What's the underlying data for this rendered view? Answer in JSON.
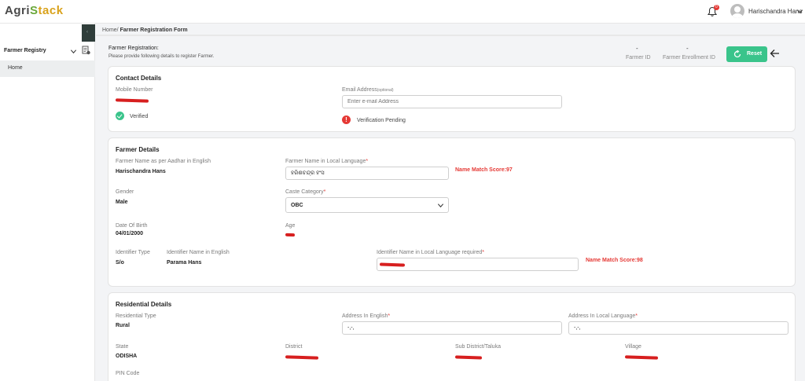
{
  "header": {
    "logo": {
      "part1": "Agri",
      "part2": "S",
      "part3": "tack"
    },
    "notification_count": "0",
    "user_name": "Harischandra Hans"
  },
  "sidebar": {
    "collapse_glyph": "‹",
    "registry_label": "Farmer Registry",
    "items": [
      {
        "label": "Home"
      }
    ]
  },
  "breadcrumb": {
    "home": "Home/",
    "current": "Farmer Registration Form"
  },
  "registration": {
    "title": "Farmer Registration:",
    "subtitle": "Please provide following details to register Farmer.",
    "farmer_id_value": "-",
    "farmer_id_label": "Farmer ID",
    "enrollment_id_value": "-",
    "enrollment_id_label": "Farmer Enrollment ID",
    "reset_label": "Reset"
  },
  "contact": {
    "title": "Contact Details",
    "mobile_label": "Mobile Number",
    "mobile_status": "Verified",
    "email_label": "Email Address",
    "email_optional": "(optional)",
    "email_placeholder": "Enter e-mail Address",
    "email_status": "Verification Pending",
    "warn_glyph": "!"
  },
  "farmer": {
    "title": "Farmer Details",
    "name_english_label": "Farmer Name as per Aadhar in English",
    "name_english_value": "Harischandra Hans",
    "name_local_label": "Farmer Name in Local Language",
    "name_local_value": "ହରିଶଚନ୍ଦ୍ର ହଂସ",
    "name_match_score_1": "Name Match Score:97",
    "gender_label": "Gender",
    "gender_value": "Male",
    "caste_label": "Caste Category",
    "caste_value": "OBC",
    "dob_label": "Date Of Birth",
    "dob_value": "04/01/2000",
    "age_label": "Age",
    "identifier_type_label": "Identifier Type",
    "identifier_type_value": "S/o",
    "identifier_name_label": "Identifier Name in English",
    "identifier_name_value": "Parama Hans",
    "identifier_local_label": "Identifier Name in Local Language required",
    "name_match_score_2": "Name Match Score:98",
    "required_mark": "*"
  },
  "residential": {
    "title": "Residential Details",
    "type_label": "Residential Type",
    "type_value": "Rural",
    "address_english_label": "Address In English",
    "address_english_value": "-,-,",
    "address_local_label": "Address In Local Language",
    "address_local_value": "-,-,",
    "state_label": "State",
    "state_value": "ODISHA",
    "district_label": "District",
    "subdistrict_label": "Sub District/Taluka",
    "village_label": "Village",
    "pincode_label": "PIN Code"
  },
  "colors": {
    "accent_green": "#3ac48b",
    "error_red": "#e53935",
    "sidebar_dark": "#2f3d3a"
  },
  "icons": [
    "bell-icon",
    "avatar-icon",
    "chevron-down-icon",
    "document-list-icon",
    "refresh-icon",
    "arrow-left-icon",
    "check-circle-icon",
    "exclamation-circle-icon"
  ]
}
